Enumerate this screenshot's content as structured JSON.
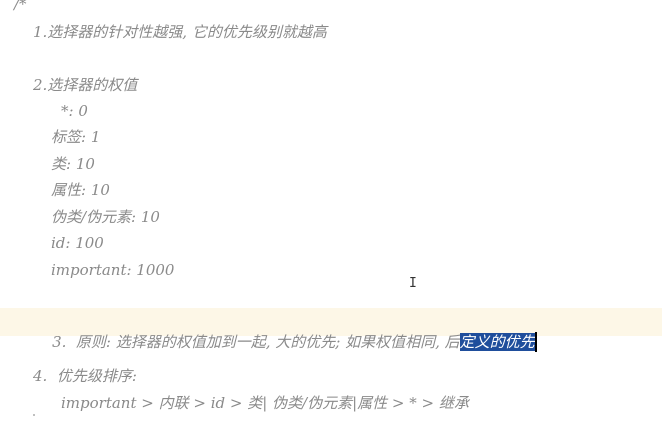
{
  "editor": {
    "comment_open": "/*",
    "rule1": "1.选择器的针对性越强, 它的优先级别就越高",
    "rule2_title": "2.选择器的权值",
    "weights": [
      "*: 0",
      "标签: 1",
      "类: 10",
      "属性: 10",
      "伪类/伪元素: 10",
      "id: 100",
      "important: 1000"
    ],
    "rule3_prefix": "3.  原则: 选择器的权值加到一起, 大的优先; 如果权值相同, 后",
    "rule3_selected": "定义的优先",
    "rule4_title": "4.  优先级排序:",
    "rule4_order": "important > 内联 > id > 类| 伪类/伪元素|属性 > * > 继承",
    "cursor_glyph": "I"
  },
  "colors": {
    "comment_text": "#8a8a8a",
    "selection": "#1f4e9c",
    "current_line": "#fdf7e7"
  }
}
